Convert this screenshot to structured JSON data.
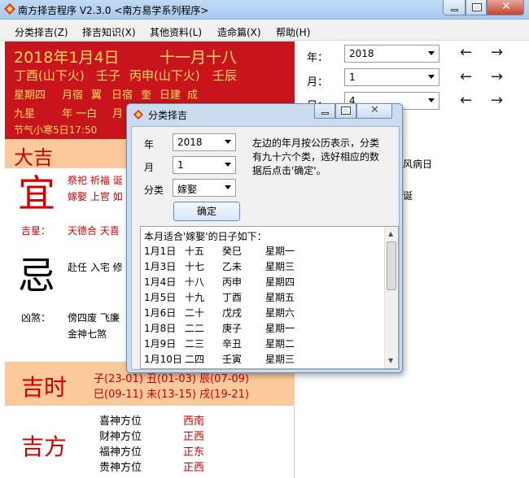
{
  "window": {
    "title": "南方择吉程序 V2.3.0    <南方易学系列程序>"
  },
  "menu": [
    "分类择吉(Z)",
    "择吉知识(X)",
    "其他资料(L)",
    "造命篇(X)",
    "帮助(H)"
  ],
  "date": {
    "solar": "2018年1月4日",
    "lunar": "十一月十八",
    "ganzhi": [
      "丁酉(山下火)",
      "壬子",
      "丙申(山下火)",
      "壬辰"
    ],
    "line3": [
      "星期四",
      "月宿",
      "翼",
      "日宿",
      "奎",
      "日建",
      "成"
    ],
    "jiuxing": "九星",
    "nianyibai": "年 一白",
    "yue": "月",
    "jieqi": "节气小寒5日17:50"
  },
  "daji": "大吉",
  "yi": {
    "char": "宜",
    "line1": "祭祀 祈福 诞",
    "line2": "嫁娶 上官 如"
  },
  "jixing": {
    "label": "吉星：",
    "value": "天德合 天喜"
  },
  "ji": {
    "char": "忌",
    "line1": "赴任 入宅 修"
  },
  "xiongsha": {
    "label": "凶煞：",
    "line1": "傍四废 飞廉",
    "line2": "金神七煞"
  },
  "jishi": {
    "label": "吉时",
    "line1": "子(23-01) 丑(01-03) 辰(07-09)",
    "line2": "巳(09-11) 未(13-15) 戌(19-21)"
  },
  "jifang": {
    "label": "吉方",
    "items": [
      {
        "name": "喜神方位",
        "dir": "西南"
      },
      {
        "name": "财神方位",
        "dir": "正西"
      },
      {
        "name": "福神方位",
        "dir": "正东"
      },
      {
        "name": "贵神方位",
        "dir": "正西"
      }
    ]
  },
  "right": {
    "year_label": "年：",
    "year": "2018",
    "month_label": "月：",
    "month": "1",
    "day_label": "日：",
    "day": "4",
    "prev": "←",
    "next": "→",
    "snippet1": "风病日",
    "snippet2": "诞"
  },
  "dialog": {
    "title": "分类择吉",
    "year_label": "年",
    "year": "2018",
    "month_label": "月",
    "month": "1",
    "cat_label": "分类",
    "category": "嫁娶",
    "help": "左边的年月按公历表示，分类有九十六个类，选好相应的数据后点击'确定'。",
    "confirm": "确定",
    "result_header": "本月适合'嫁娶'的日子如下：",
    "rows": [
      {
        "d": "1月1日",
        "l": "十五",
        "g": "癸巳",
        "w": "星期一"
      },
      {
        "d": "1月3日",
        "l": "十七",
        "g": "乙未",
        "w": "星期三"
      },
      {
        "d": "1月4日",
        "l": "十八",
        "g": "丙申",
        "w": "星期四"
      },
      {
        "d": "1月5日",
        "l": "十九",
        "g": "丁酉",
        "w": "星期五"
      },
      {
        "d": "1月6日",
        "l": "二十",
        "g": "戊戌",
        "w": "星期六"
      },
      {
        "d": "1月8日",
        "l": "二二",
        "g": "庚子",
        "w": "星期一"
      },
      {
        "d": "1月9日",
        "l": "二三",
        "g": "辛丑",
        "w": "星期二"
      },
      {
        "d": "1月10日",
        "l": "二四",
        "g": "壬寅",
        "w": "星期三"
      }
    ]
  }
}
